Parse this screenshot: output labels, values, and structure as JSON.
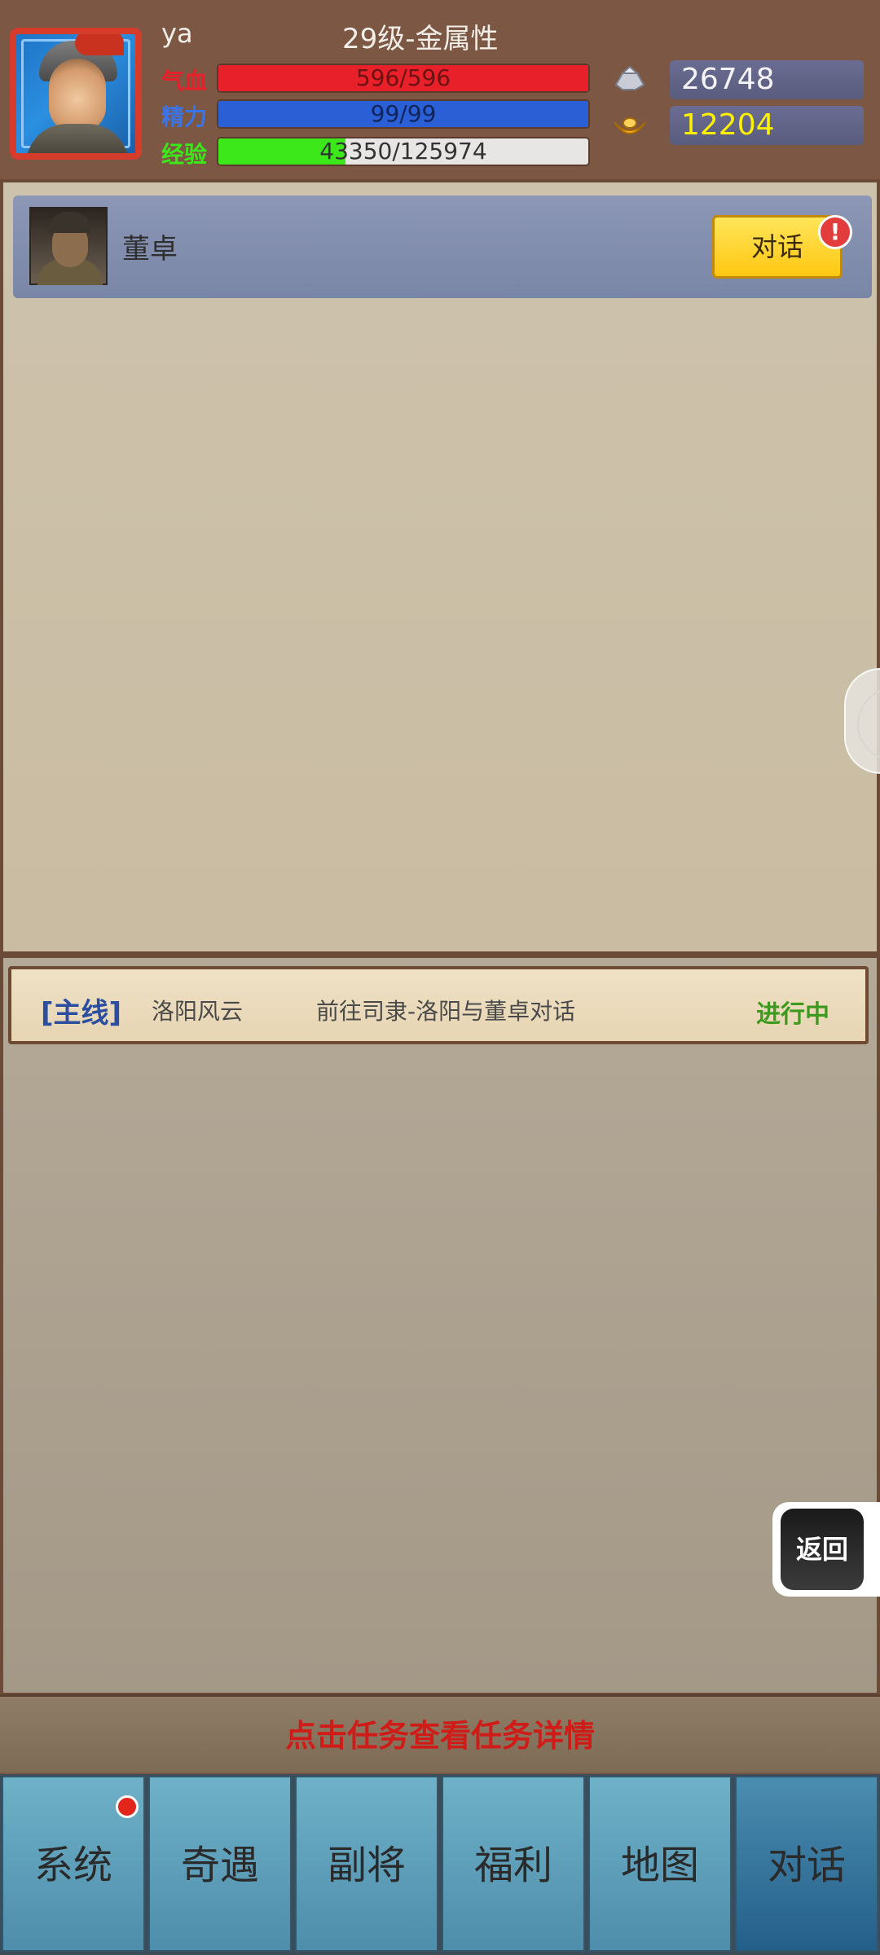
{
  "player": {
    "name": "ya",
    "level_text": "29级-金属性"
  },
  "stats": {
    "hp": {
      "label": "气血",
      "text": "596/596",
      "fraction": 1.0,
      "color": "#e8202a"
    },
    "mp": {
      "label": "精力",
      "text": "99/99",
      "fraction": 1.0,
      "color": "#2a5fd6"
    },
    "xp": {
      "label": "经验",
      "text": "43350/125974",
      "fraction": 0.344,
      "color": "#3de81a"
    }
  },
  "resources": {
    "silver": {
      "value": "26748",
      "icon": "silver-ingot-icon"
    },
    "gold": {
      "value": "12204",
      "icon": "gold-ingot-icon"
    }
  },
  "npc": {
    "name": "董卓",
    "talk_label": "对话",
    "badge": "!"
  },
  "quest": {
    "type": "[主线]",
    "name": "洛阳风云",
    "desc": "前往司隶-洛阳与董卓对话",
    "status": "进行中"
  },
  "hint": "点击任务查看任务详情",
  "back_label": "返回",
  "nav": [
    {
      "label": "系统",
      "notify": true
    },
    {
      "label": "奇遇",
      "notify": false
    },
    {
      "label": "副将",
      "notify": false
    },
    {
      "label": "福利",
      "notify": false
    },
    {
      "label": "地图",
      "notify": false
    },
    {
      "label": "对话",
      "active": true
    }
  ]
}
